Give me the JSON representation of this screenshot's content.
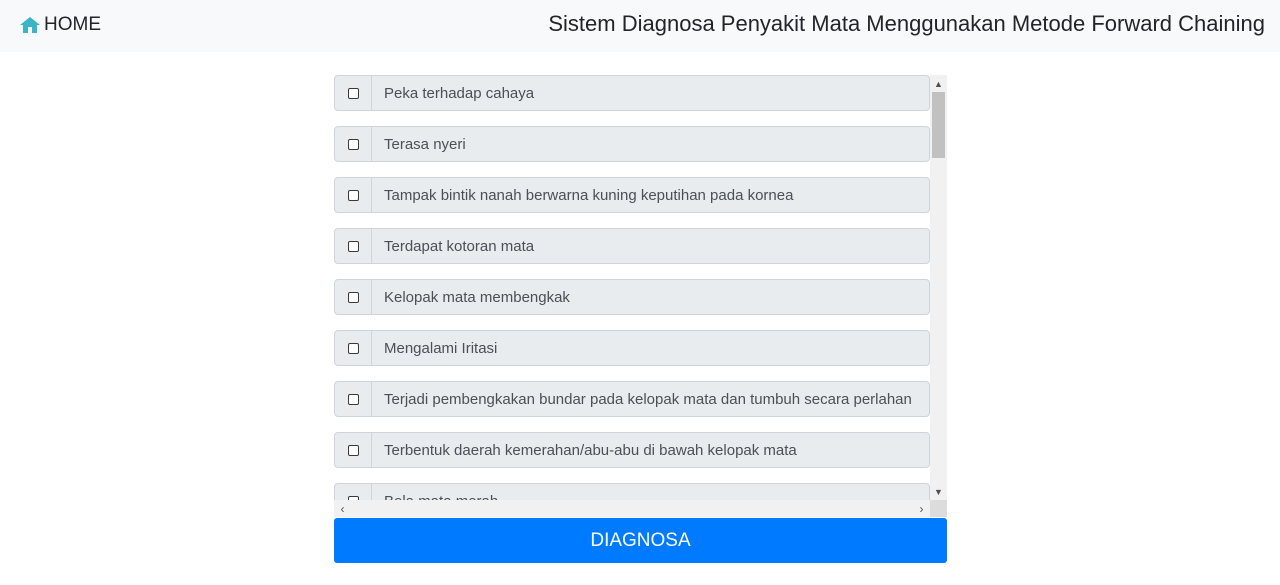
{
  "navbar": {
    "home_label": "HOME",
    "home_icon": "home-icon",
    "title": "Sistem Diagnosa Penyakit Mata Menggunakan Metode Forward Chaining"
  },
  "symptoms": [
    {
      "label": "Peka terhadap cahaya",
      "checked": false
    },
    {
      "label": "Terasa nyeri",
      "checked": false
    },
    {
      "label": "Tampak bintik nanah berwarna kuning keputihan pada kornea",
      "checked": false
    },
    {
      "label": "Terdapat kotoran mata",
      "checked": false
    },
    {
      "label": "Kelopak mata membengkak",
      "checked": false
    },
    {
      "label": "Mengalami Iritasi",
      "checked": false
    },
    {
      "label": "Terjadi pembengkakan bundar pada kelopak mata dan tumbuh secara perlahan",
      "checked": false
    },
    {
      "label": "Terbentuk daerah kemerahan/abu-abu di bawah kelopak mata",
      "checked": false
    },
    {
      "label": "Bola mata merah",
      "checked": false
    }
  ],
  "scrollbar": {
    "up_icon": "chevron-up-icon",
    "down_icon": "chevron-down-icon",
    "left_icon": "chevron-left-icon",
    "right_icon": "chevron-right-icon"
  },
  "colors": {
    "navbar_bg": "#f8f9fa",
    "row_bg": "#e9ecef",
    "button_bg": "#007bff",
    "home_icon": "#17a2b8"
  },
  "diagnose_button": {
    "label": "DIAGNOSA"
  }
}
